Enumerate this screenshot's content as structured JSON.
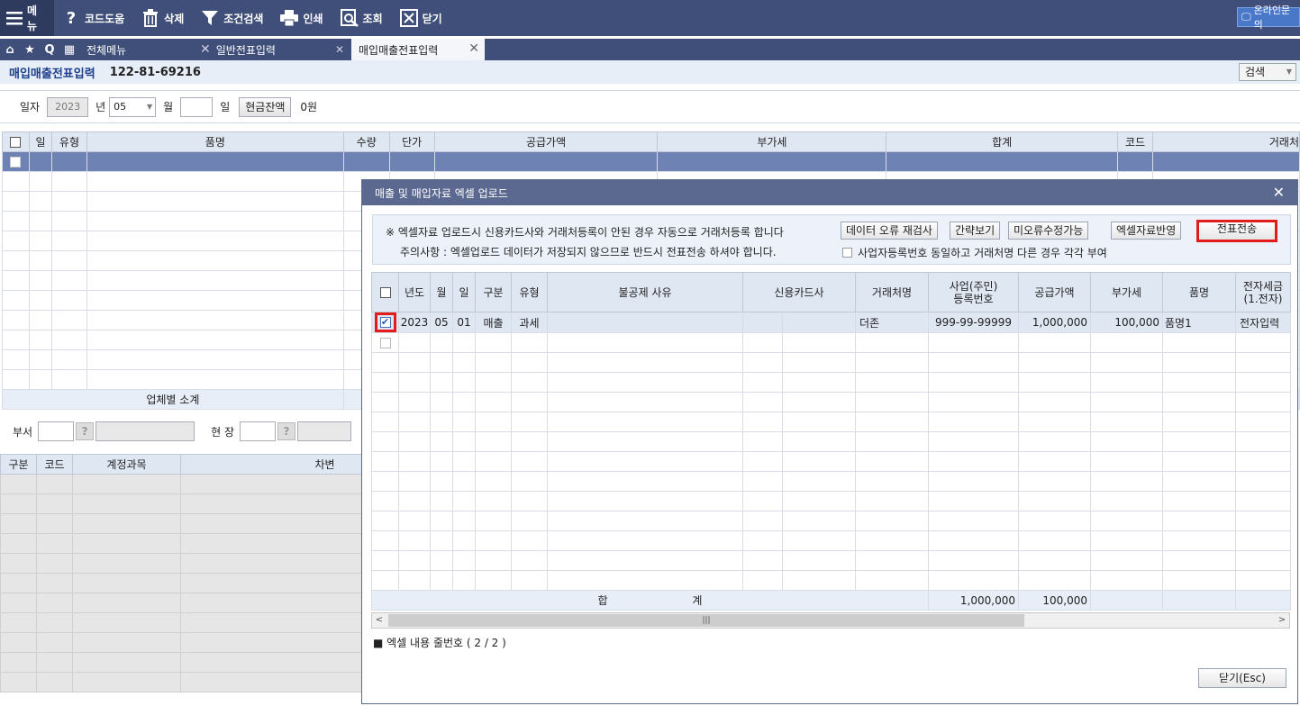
{
  "toolbar": {
    "menu": "메뉴",
    "code_help": "코드도움",
    "delete": "삭제",
    "filter_search": "조건검색",
    "print": "인쇄",
    "lookup": "조회",
    "close": "닫기",
    "online_inquiry": "온라인문의"
  },
  "tabs": [
    {
      "label": "전체메뉴"
    },
    {
      "label": "일반전표입력"
    },
    {
      "label": "매입매출전표입력"
    }
  ],
  "page": {
    "title": "매입매출전표입력",
    "biz_no": "122-81-69216",
    "search_label": "검색"
  },
  "filter": {
    "date_label": "일자",
    "year": "2023",
    "year_unit": "년",
    "month": "05",
    "month_unit": "월",
    "day": "",
    "day_unit": "일",
    "cash_balance_button": "현금잔액",
    "cash_balance_value": "0원"
  },
  "main_grid": {
    "headers": [
      "일",
      "유형",
      "품명",
      "수량",
      "단가",
      "공급가액",
      "부가세",
      "합계",
      "코드",
      "거래처"
    ],
    "subtotal_label": "업체별 소계"
  },
  "dept_row": {
    "dept_label": "부서",
    "site_label": "현 장",
    "help_glyph": "?"
  },
  "bottom_grid": {
    "headers": [
      "구분",
      "코드",
      "계정과목",
      "차변"
    ]
  },
  "modal": {
    "title": "매출 및 매입자료 엑셀 업로드",
    "notice1": "※ 엑셀자료 업로드시 신용카드사와 거래처등록이 안된 경우 자동으로 거래처등록 합니다",
    "notice2": "주의사항 : 엑셀업로드 데이터가 저장되지 않으므로 반드시 전표전송 하셔야 합니다.",
    "btn_recheck": "데이터 오류 재검사",
    "btn_brief": "간략보기",
    "btn_unfixed": "미오류수정가능",
    "btn_apply": "엑셀자료반영",
    "btn_send": "전표전송",
    "checkbox_label": "사업자등록번호 동일하고 거래처명 다른 경우 각각 부여",
    "headers": {
      "year": "년도",
      "month": "월",
      "day": "일",
      "category": "구분",
      "type": "유형",
      "nondeduct": "불공제 사유",
      "card": "신용카드사",
      "partner": "거래처명",
      "bizno_1": "사업(주민)",
      "bizno_2": "등록번호",
      "supply": "공급가액",
      "vat": "부가세",
      "item": "품명",
      "etax_1": "전자세금",
      "etax_2": "(1.전자)"
    },
    "row": {
      "year": "2023",
      "month": "05",
      "day": "01",
      "category": "매출",
      "type": "과세",
      "partner": "더존",
      "bizno": "999-99-99999",
      "supply": "1,000,000",
      "vat": "100,000",
      "item": "품명1",
      "etax": "전자입력"
    },
    "total_label_1": "합",
    "total_label_2": "계",
    "total_supply": "1,000,000",
    "total_vat": "100,000",
    "footer": "■ 엑셀 내용 줄번호 ( 2 / 2 )",
    "close_button": "닫기(Esc)",
    "scroll_grip": "|||"
  }
}
